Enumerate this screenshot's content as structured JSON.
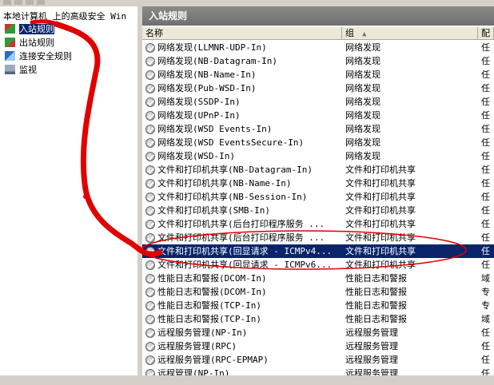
{
  "tree": {
    "root_label": "本地计算机 上的高级安全 Win",
    "items": [
      {
        "label": "入站规则",
        "selected": true,
        "icon": "inbound-rules-icon"
      },
      {
        "label": "出站规则",
        "selected": false,
        "icon": "outbound-rules-icon"
      },
      {
        "label": "连接安全规则",
        "selected": false,
        "icon": "connection-security-icon"
      },
      {
        "label": "监视",
        "selected": false,
        "icon": "monitor-icon"
      }
    ]
  },
  "pane": {
    "title": "入站规则",
    "columns": {
      "name": "名称",
      "group": "组",
      "profile": "配"
    }
  },
  "rules": [
    {
      "name": "网络发现(LLMNR-UDP-In)",
      "group": "网络发现",
      "profile": "任"
    },
    {
      "name": "网络发现(NB-Datagram-In)",
      "group": "网络发现",
      "profile": "任"
    },
    {
      "name": "网络发现(NB-Name-In)",
      "group": "网络发现",
      "profile": "任"
    },
    {
      "name": "网络发现(Pub-WSD-In)",
      "group": "网络发现",
      "profile": "任"
    },
    {
      "name": "网络发现(SSDP-In)",
      "group": "网络发现",
      "profile": "任"
    },
    {
      "name": "网络发现(UPnP-In)",
      "group": "网络发现",
      "profile": "任"
    },
    {
      "name": "网络发现(WSD Events-In)",
      "group": "网络发现",
      "profile": "任"
    },
    {
      "name": "网络发现(WSD EventsSecure-In)",
      "group": "网络发现",
      "profile": "任"
    },
    {
      "name": "网络发现(WSD-In)",
      "group": "网络发现",
      "profile": "任"
    },
    {
      "name": "文件和打印机共享(NB-Datagram-In)",
      "group": "文件和打印机共享",
      "profile": "任"
    },
    {
      "name": "文件和打印机共享(NB-Name-In)",
      "group": "文件和打印机共享",
      "profile": "任"
    },
    {
      "name": "文件和打印机共享(NB-Session-In)",
      "group": "文件和打印机共享",
      "profile": "任"
    },
    {
      "name": "文件和打印机共享(SMB-In)",
      "group": "文件和打印机共享",
      "profile": "任"
    },
    {
      "name": "文件和打印机共享(后台打印程序服务 ...",
      "group": "文件和打印机共享",
      "profile": "任"
    },
    {
      "name": "文件和打印机共享(后台打印程序服务 ...",
      "group": "文件和打印机共享",
      "profile": "任"
    },
    {
      "name": "文件和打印机共享(回显请求 - ICMPv4...",
      "group": "文件和打印机共享",
      "profile": "任",
      "selected": true
    },
    {
      "name": "文件和打印机共享(回显请求 - ICMPv6...",
      "group": "文件和打印机共享",
      "profile": "任"
    },
    {
      "name": "性能日志和警报(DCOM-In)",
      "group": "性能日志和警报",
      "profile": "域"
    },
    {
      "name": "性能日志和警报(DCOM-In)",
      "group": "性能日志和警报",
      "profile": "专"
    },
    {
      "name": "性能日志和警报(TCP-In)",
      "group": "性能日志和警报",
      "profile": "专"
    },
    {
      "name": "性能日志和警报(TCP-In)",
      "group": "性能日志和警报",
      "profile": "域"
    },
    {
      "name": "远程服务管理(NP-In)",
      "group": "远程服务管理",
      "profile": "任"
    },
    {
      "name": "远程服务管理(RPC)",
      "group": "远程服务管理",
      "profile": "任"
    },
    {
      "name": "远程服务管理(RPC-EPMAP)",
      "group": "远程服务管理",
      "profile": "任"
    },
    {
      "name": "远程管理(NP-In)",
      "group": "远程服务管理",
      "profile": "任"
    }
  ],
  "colors": {
    "selection": "#0a246a",
    "annotation": "#e00000",
    "title_bar": "#7a7a7a"
  }
}
